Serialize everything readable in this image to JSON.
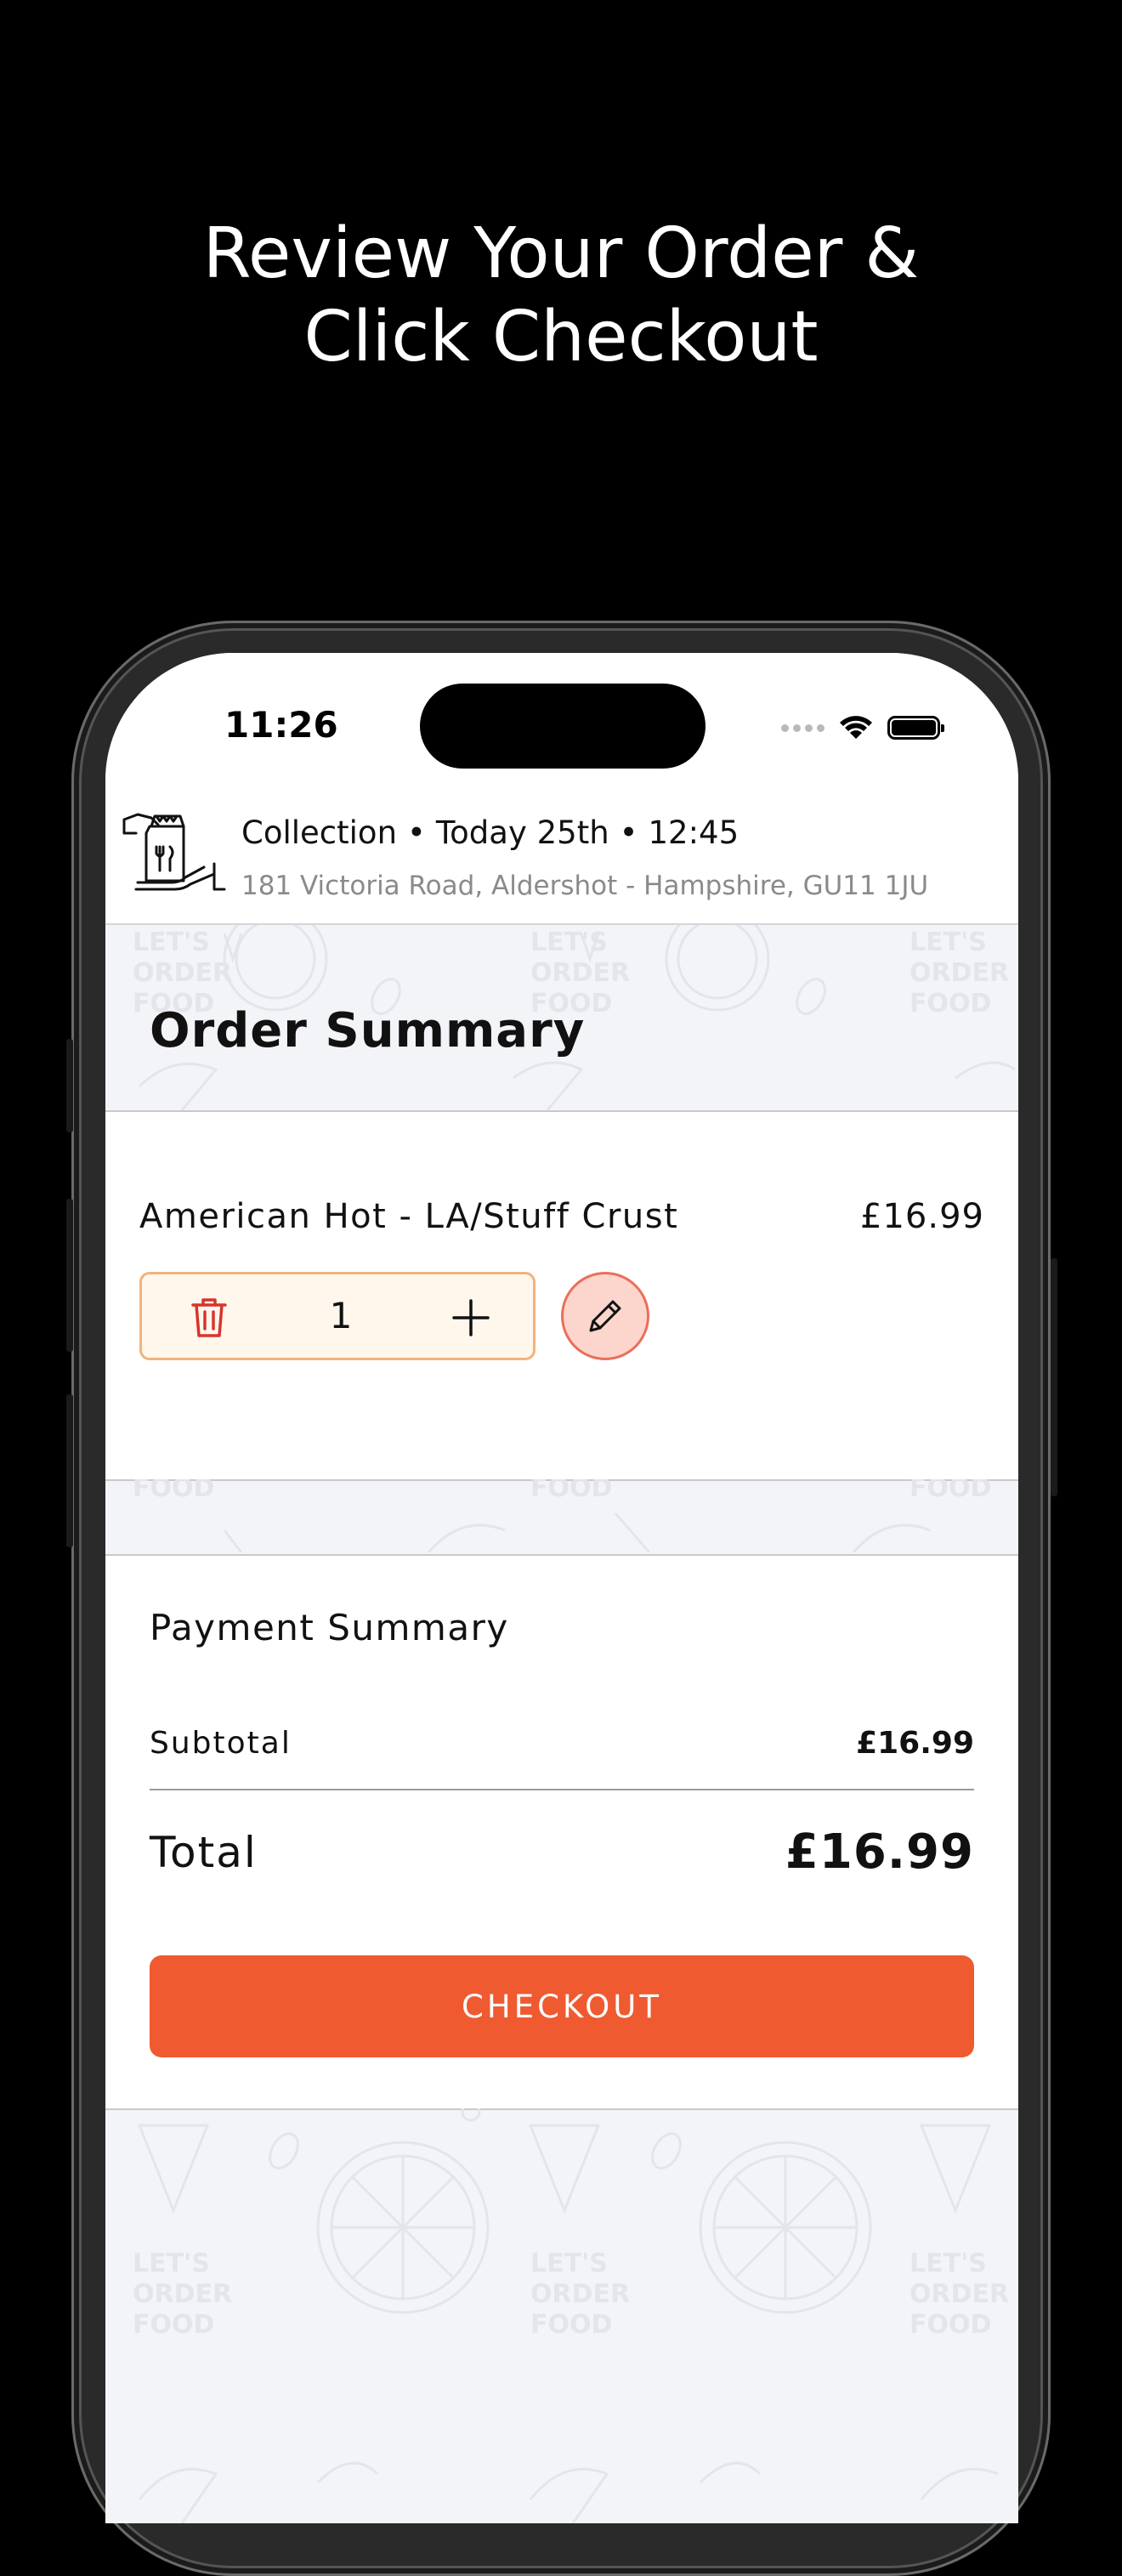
{
  "promo": {
    "headline_line1": "Review Your Order &",
    "headline_line2": "Click Checkout"
  },
  "status_bar": {
    "time": "11:26"
  },
  "collection": {
    "mode": "Collection",
    "day": "Today 25th",
    "slot": "12:45",
    "separator": "•",
    "address": "181 Victoria Road, Aldershot - Hampshire, GU11  1JU"
  },
  "background_pattern": {
    "text_line1": "LET'S",
    "text_line2": "ORDER",
    "text_line3": "FOOD"
  },
  "order": {
    "title": "Order Summary",
    "items": [
      {
        "name": "American Hot - LA/Stuff Crust",
        "price": "£16.99",
        "quantity": "1"
      }
    ]
  },
  "payment": {
    "title": "Payment Summary",
    "subtotal_label": "Subtotal",
    "subtotal_value": "£16.99",
    "total_label": "Total",
    "total_value": "£16.99",
    "checkout_label": "CHECKOUT"
  },
  "colors": {
    "accent": "#f05a30",
    "qty_box_bg": "#fff7ec",
    "qty_box_border": "#f2b37c",
    "edit_bg": "#fcd5cc",
    "trash_icon": "#d9342b",
    "screen_bg": "#f3f4f8"
  }
}
